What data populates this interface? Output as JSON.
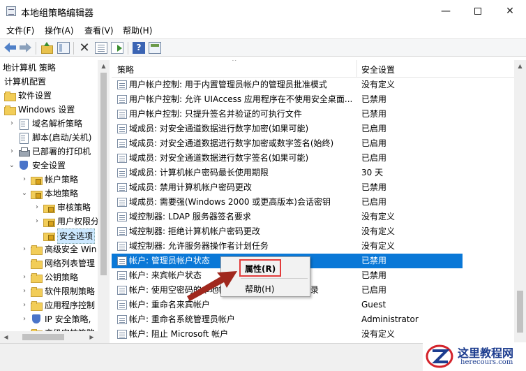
{
  "window": {
    "title": "本地组策略编辑器",
    "buttons": {
      "minimize": "—",
      "maximize": "",
      "close": "✕"
    }
  },
  "menu": [
    "文件(F)",
    "操作(A)",
    "查看(V)",
    "帮助(H)"
  ],
  "toolbar": {
    "icons": [
      "back-arrow-icon",
      "forward-arrow-icon",
      "folder-up-icon",
      "show-hide-tree-icon",
      "delete-icon",
      "properties-icon",
      "export-list-icon",
      "help-icon",
      "panel-icon"
    ],
    "help_glyph": "?",
    "delete_glyph": "✕"
  },
  "tree": {
    "items": [
      {
        "label": "地计算机 策略",
        "twisty": "",
        "icon": "none"
      },
      {
        "label": "计算机配置",
        "twisty": "",
        "icon": "none"
      },
      {
        "label": "软件设置",
        "twisty": "",
        "icon": "folder"
      },
      {
        "label": "Windows 设置",
        "twisty": "",
        "icon": "folder"
      },
      {
        "label": "域名解析策略",
        "twisty": "›",
        "icon": "doc"
      },
      {
        "label": "脚本(启动/关机)",
        "twisty": "",
        "icon": "doc"
      },
      {
        "label": "已部署的打印机",
        "twisty": "›",
        "icon": "printer"
      },
      {
        "label": "安全设置",
        "twisty": "⌄",
        "icon": "shield"
      },
      {
        "label": "帐户策略",
        "twisty": "›",
        "icon": "lockfolder"
      },
      {
        "label": "本地策略",
        "twisty": "⌄",
        "icon": "lockfolder"
      },
      {
        "label": "审核策略",
        "twisty": "›",
        "icon": "lockfolder"
      },
      {
        "label": "用户权限分",
        "twisty": "›",
        "icon": "lockfolder"
      },
      {
        "label": "安全选项",
        "twisty": "",
        "icon": "lockfolder",
        "selected": true
      },
      {
        "label": "高级安全 Win",
        "twisty": "›",
        "icon": "folder"
      },
      {
        "label": "网络列表管理",
        "twisty": "",
        "icon": "folder"
      },
      {
        "label": "公钥策略",
        "twisty": "›",
        "icon": "folder"
      },
      {
        "label": "软件限制策略",
        "twisty": "›",
        "icon": "folder"
      },
      {
        "label": "应用程序控制",
        "twisty": "›",
        "icon": "folder"
      },
      {
        "label": "IP 安全策略,",
        "twisty": "›",
        "icon": "shield"
      },
      {
        "label": "高级审核策略",
        "twisty": "›",
        "icon": "folder"
      }
    ]
  },
  "list": {
    "columns": {
      "policy": "策略",
      "setting": "安全设置"
    },
    "rows": [
      {
        "policy": "用户帐户控制: 用于内置管理员帐户的管理员批准模式",
        "setting": "没有定义"
      },
      {
        "policy": "用户帐户控制: 允许 UIAccess 应用程序在不使用安全桌面...",
        "setting": "已禁用"
      },
      {
        "policy": "用户帐户控制: 只提升签名并验证的可执行文件",
        "setting": "已禁用"
      },
      {
        "policy": "域成员: 对安全通道数据进行数字加密(如果可能)",
        "setting": "已启用"
      },
      {
        "policy": "域成员: 对安全通道数据进行数字加密或数字签名(始终)",
        "setting": "已启用"
      },
      {
        "policy": "域成员: 对安全通道数据进行数字签名(如果可能)",
        "setting": "已启用"
      },
      {
        "policy": "域成员: 计算机帐户密码最长使用期限",
        "setting": "30 天"
      },
      {
        "policy": "域成员: 禁用计算机帐户密码更改",
        "setting": "已禁用"
      },
      {
        "policy": "域成员: 需要强(Windows 2000 或更高版本)会话密钥",
        "setting": "已启用"
      },
      {
        "policy": "域控制器: LDAP 服务器签名要求",
        "setting": "没有定义"
      },
      {
        "policy": "域控制器: 拒绝计算机帐户密码更改",
        "setting": "没有定义"
      },
      {
        "policy": "域控制器: 允许服务器操作者计划任务",
        "setting": "没有定义"
      },
      {
        "policy": "帐户: 管理员帐户状态",
        "setting": "已禁用",
        "selected": true
      },
      {
        "policy": "帐户: 来宾帐户状态",
        "setting": "已禁用"
      },
      {
        "policy": "帐户: 使用空密码的本地帐户只允许进行控制台登录",
        "setting": "已启用"
      },
      {
        "policy": "帐户: 重命名来宾帐户",
        "setting": "Guest"
      },
      {
        "policy": "帐户: 重命名系统管理员帐户",
        "setting": "Administrator"
      },
      {
        "policy": "帐户: 阻止 Microsoft 帐户",
        "setting": "没有定义"
      }
    ]
  },
  "context_menu": {
    "items": [
      {
        "label": "属性(R)",
        "bold": true
      },
      {
        "label": "帮助(H)",
        "bold": false
      }
    ]
  },
  "watermark": {
    "title": "这里教程网",
    "subtitle": "herecours.com"
  },
  "colors": {
    "selection": "#0a78d7",
    "highlight_box": "#e23b3b",
    "annotation_arrow": "#a0281e",
    "watermark_text": "#1d3d8f"
  }
}
